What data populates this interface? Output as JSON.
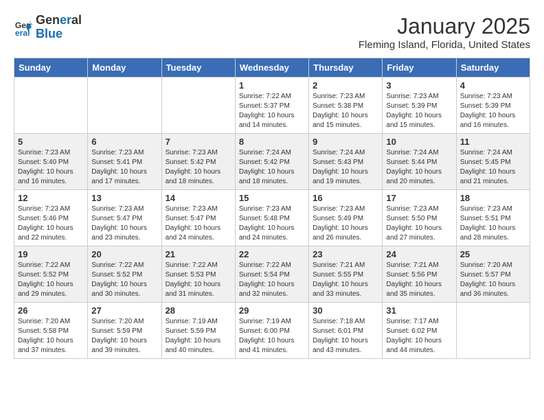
{
  "header": {
    "logo_line1": "General",
    "logo_line2": "Blue",
    "month": "January 2025",
    "location": "Fleming Island, Florida, United States"
  },
  "days_of_week": [
    "Sunday",
    "Monday",
    "Tuesday",
    "Wednesday",
    "Thursday",
    "Friday",
    "Saturday"
  ],
  "weeks": [
    [
      {
        "day": "",
        "info": ""
      },
      {
        "day": "",
        "info": ""
      },
      {
        "day": "",
        "info": ""
      },
      {
        "day": "1",
        "info": "Sunrise: 7:22 AM\nSunset: 5:37 PM\nDaylight: 10 hours\nand 14 minutes."
      },
      {
        "day": "2",
        "info": "Sunrise: 7:23 AM\nSunset: 5:38 PM\nDaylight: 10 hours\nand 15 minutes."
      },
      {
        "day": "3",
        "info": "Sunrise: 7:23 AM\nSunset: 5:39 PM\nDaylight: 10 hours\nand 15 minutes."
      },
      {
        "day": "4",
        "info": "Sunrise: 7:23 AM\nSunset: 5:39 PM\nDaylight: 10 hours\nand 16 minutes."
      }
    ],
    [
      {
        "day": "5",
        "info": "Sunrise: 7:23 AM\nSunset: 5:40 PM\nDaylight: 10 hours\nand 16 minutes."
      },
      {
        "day": "6",
        "info": "Sunrise: 7:23 AM\nSunset: 5:41 PM\nDaylight: 10 hours\nand 17 minutes."
      },
      {
        "day": "7",
        "info": "Sunrise: 7:23 AM\nSunset: 5:42 PM\nDaylight: 10 hours\nand 18 minutes."
      },
      {
        "day": "8",
        "info": "Sunrise: 7:24 AM\nSunset: 5:42 PM\nDaylight: 10 hours\nand 18 minutes."
      },
      {
        "day": "9",
        "info": "Sunrise: 7:24 AM\nSunset: 5:43 PM\nDaylight: 10 hours\nand 19 minutes."
      },
      {
        "day": "10",
        "info": "Sunrise: 7:24 AM\nSunset: 5:44 PM\nDaylight: 10 hours\nand 20 minutes."
      },
      {
        "day": "11",
        "info": "Sunrise: 7:24 AM\nSunset: 5:45 PM\nDaylight: 10 hours\nand 21 minutes."
      }
    ],
    [
      {
        "day": "12",
        "info": "Sunrise: 7:23 AM\nSunset: 5:46 PM\nDaylight: 10 hours\nand 22 minutes."
      },
      {
        "day": "13",
        "info": "Sunrise: 7:23 AM\nSunset: 5:47 PM\nDaylight: 10 hours\nand 23 minutes."
      },
      {
        "day": "14",
        "info": "Sunrise: 7:23 AM\nSunset: 5:47 PM\nDaylight: 10 hours\nand 24 minutes."
      },
      {
        "day": "15",
        "info": "Sunrise: 7:23 AM\nSunset: 5:48 PM\nDaylight: 10 hours\nand 24 minutes."
      },
      {
        "day": "16",
        "info": "Sunrise: 7:23 AM\nSunset: 5:49 PM\nDaylight: 10 hours\nand 26 minutes."
      },
      {
        "day": "17",
        "info": "Sunrise: 7:23 AM\nSunset: 5:50 PM\nDaylight: 10 hours\nand 27 minutes."
      },
      {
        "day": "18",
        "info": "Sunrise: 7:23 AM\nSunset: 5:51 PM\nDaylight: 10 hours\nand 28 minutes."
      }
    ],
    [
      {
        "day": "19",
        "info": "Sunrise: 7:22 AM\nSunset: 5:52 PM\nDaylight: 10 hours\nand 29 minutes."
      },
      {
        "day": "20",
        "info": "Sunrise: 7:22 AM\nSunset: 5:52 PM\nDaylight: 10 hours\nand 30 minutes."
      },
      {
        "day": "21",
        "info": "Sunrise: 7:22 AM\nSunset: 5:53 PM\nDaylight: 10 hours\nand 31 minutes."
      },
      {
        "day": "22",
        "info": "Sunrise: 7:22 AM\nSunset: 5:54 PM\nDaylight: 10 hours\nand 32 minutes."
      },
      {
        "day": "23",
        "info": "Sunrise: 7:21 AM\nSunset: 5:55 PM\nDaylight: 10 hours\nand 33 minutes."
      },
      {
        "day": "24",
        "info": "Sunrise: 7:21 AM\nSunset: 5:56 PM\nDaylight: 10 hours\nand 35 minutes."
      },
      {
        "day": "25",
        "info": "Sunrise: 7:20 AM\nSunset: 5:57 PM\nDaylight: 10 hours\nand 36 minutes."
      }
    ],
    [
      {
        "day": "26",
        "info": "Sunrise: 7:20 AM\nSunset: 5:58 PM\nDaylight: 10 hours\nand 37 minutes."
      },
      {
        "day": "27",
        "info": "Sunrise: 7:20 AM\nSunset: 5:59 PM\nDaylight: 10 hours\nand 39 minutes."
      },
      {
        "day": "28",
        "info": "Sunrise: 7:19 AM\nSunset: 5:59 PM\nDaylight: 10 hours\nand 40 minutes."
      },
      {
        "day": "29",
        "info": "Sunrise: 7:19 AM\nSunset: 6:00 PM\nDaylight: 10 hours\nand 41 minutes."
      },
      {
        "day": "30",
        "info": "Sunrise: 7:18 AM\nSunset: 6:01 PM\nDaylight: 10 hours\nand 43 minutes."
      },
      {
        "day": "31",
        "info": "Sunrise: 7:17 AM\nSunset: 6:02 PM\nDaylight: 10 hours\nand 44 minutes."
      },
      {
        "day": "",
        "info": ""
      }
    ]
  ]
}
